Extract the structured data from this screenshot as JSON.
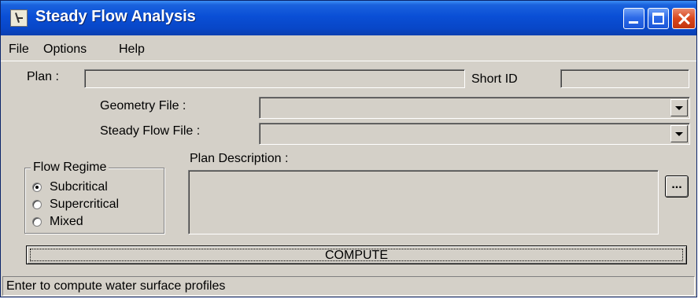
{
  "window": {
    "title": "Steady Flow Analysis"
  },
  "menu": {
    "file": "File",
    "options": "Options",
    "help": "Help"
  },
  "plan": {
    "label": "Plan :",
    "value": ""
  },
  "short_id": {
    "label": "Short ID",
    "value": ""
  },
  "geometry_file": {
    "label": "Geometry File :",
    "value": ""
  },
  "steady_flow_file": {
    "label": "Steady Flow File :",
    "value": ""
  },
  "flow_regime": {
    "title": "Flow Regime",
    "options": [
      {
        "label": "Subcritical",
        "selected": true
      },
      {
        "label": "Supercritical",
        "selected": false
      },
      {
        "label": "Mixed",
        "selected": false
      }
    ]
  },
  "plan_description": {
    "label": "Plan Description :",
    "value": "",
    "browse_label": "..."
  },
  "compute_button": "COMPUTE",
  "status_bar": "Enter to compute water surface profiles"
}
